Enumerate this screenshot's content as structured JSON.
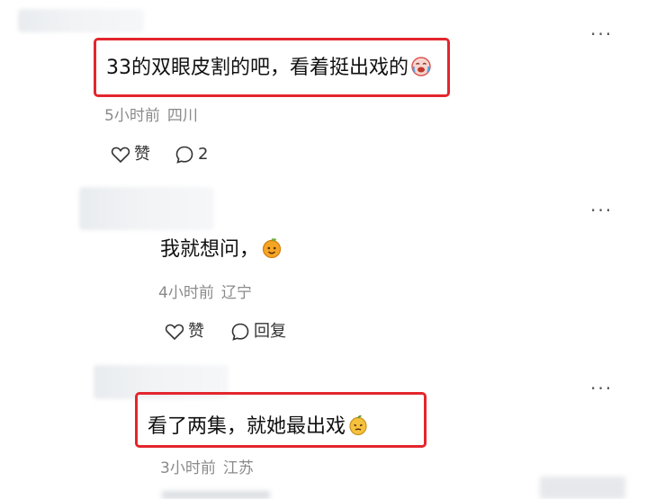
{
  "comments": [
    {
      "text": "33的双眼皮割的吧，看着挺出戏的",
      "emoji": "crying-laughing-emoji",
      "time": "5小时前",
      "location": "四川",
      "like_label": "赞",
      "reply_count": "2",
      "more": "···"
    },
    {
      "text": "我就想问，",
      "emoji": "orange-face-emoji",
      "time": "4小时前",
      "location": "辽宁",
      "like_label": "赞",
      "reply_label": "回复",
      "more": "···"
    },
    {
      "text": "看了两集，就她最出戏",
      "emoji": "mango-face-emoji",
      "time": "3小时前",
      "location": "江苏",
      "more": "···"
    }
  ],
  "colors": {
    "highlight": "#e3262d",
    "meta": "#8a8a8a",
    "text": "#111111"
  }
}
